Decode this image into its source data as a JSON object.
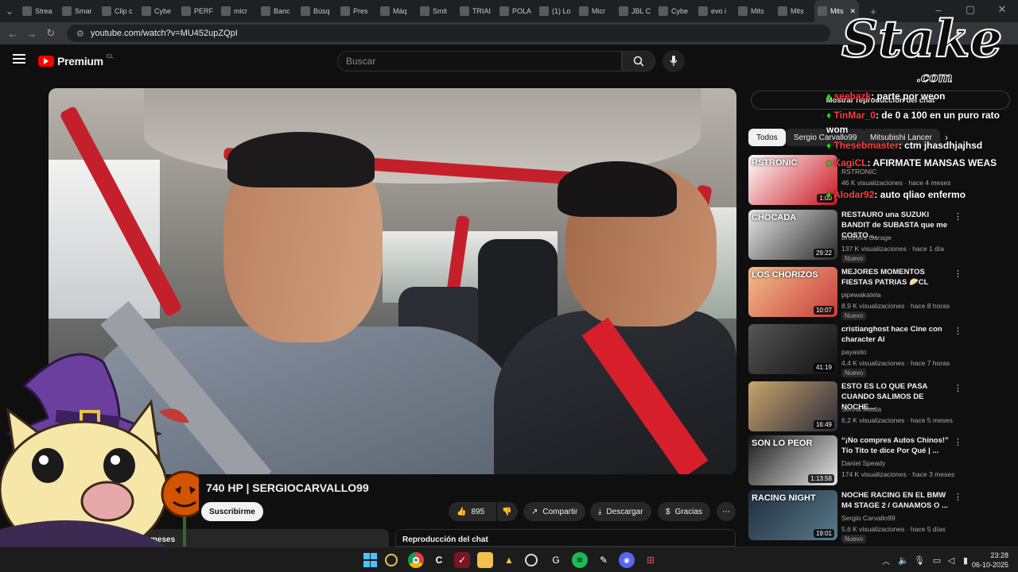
{
  "tabs": [
    {
      "label": "Strea",
      "icon": "twitch-icon"
    },
    {
      "label": "Smar",
      "icon": "triangle-icon"
    },
    {
      "label": "Clip c",
      "icon": "triangle-icon"
    },
    {
      "label": "Cybe",
      "icon": "globe-icon"
    },
    {
      "label": "PERF",
      "icon": "logo-icon"
    },
    {
      "label": "micr",
      "icon": "puzzle-icon"
    },
    {
      "label": "Banc",
      "icon": "ir-icon"
    },
    {
      "label": "Búsq",
      "icon": "ir-icon"
    },
    {
      "label": "Pres",
      "icon": "ir-icon"
    },
    {
      "label": "Máq",
      "icon": "ir-icon"
    },
    {
      "label": "Smit",
      "icon": "ir-icon"
    },
    {
      "label": "TRIAI",
      "icon": "t-icon"
    },
    {
      "label": "POLA",
      "icon": "google-icon"
    },
    {
      "label": "(1) Lo",
      "icon": "youtube-icon"
    },
    {
      "label": "Micr",
      "icon": "puzzle-icon"
    },
    {
      "label": "JBL C",
      "icon": "jbl-icon"
    },
    {
      "label": "Cybe",
      "icon": "shield-icon"
    },
    {
      "label": "evo i",
      "icon": "google-icon"
    },
    {
      "label": "Mits",
      "icon": "mitsubishi-icon"
    },
    {
      "label": "Mits",
      "icon": "mitsubishi-icon"
    },
    {
      "label": "Mits",
      "icon": "mitsubishi-icon"
    }
  ],
  "address": {
    "url": "youtube.com/watch?v=MU452upZQpI"
  },
  "youtube": {
    "logo": "Premium",
    "region": "CL",
    "search_placeholder": "Buscar",
    "video_title_partial": "ut",
    "video_title_rest": "740 HP | SERGIOCARVALLO99",
    "subscribe_label": "Suscribirme",
    "likes": "895",
    "share_label": "Compartir",
    "download_label": "Descargar",
    "thanks_label": "Gracias",
    "desc_partial": "meses",
    "chat_replay_label": "Reproducción del chat",
    "show_chat_label": "Mostrar reproducción del chat"
  },
  "chips": [
    {
      "label": "Todos",
      "active": true
    },
    {
      "label": "Sergio Carvallo99",
      "active": false
    },
    {
      "label": "Mitsubishi Lancer",
      "active": false
    }
  ],
  "recommendations": [
    {
      "title": "",
      "channel": "RSTRONIC",
      "meta": "46 K visualizaciones · hace 4 meses",
      "duration": "1:00",
      "badge": "",
      "thumb_text": "RSTRONIC"
    },
    {
      "title": "RESTAURO una SUZUKI BANDIT de SUBASTA que me COSTO ...",
      "channel": "Brothers Garage",
      "meta": "137 K visualizaciones · hace 1 día",
      "duration": "29:22",
      "badge": "Nuevo",
      "thumb_text": "CHOCADA"
    },
    {
      "title": "MEJORES MOMENTOS FIESTAS PATRIAS 🥟CL",
      "channel": "pipewakatela",
      "meta": "8,9 K visualizaciones · hace 8 horas",
      "duration": "10:07",
      "badge": "Nuevo",
      "thumb_text": "LOS CHORIZOS"
    },
    {
      "title": "cristianghost hace Cine con character AI",
      "channel": "payasito",
      "meta": "4,4 K visualizaciones · hace 7 horas",
      "duration": "41:19",
      "badge": "Nuevo",
      "thumb_text": ""
    },
    {
      "title": "ESTO ES LO QUE PASA CUANDO SALIMOS DE NOCHE...",
      "channel": "Senna Media",
      "meta": "6,2 K visualizaciones · hace 5 meses",
      "duration": "16:49",
      "badge": "",
      "thumb_text": ""
    },
    {
      "title": "“¡No compres Autos Chinos!” Tío Tito te dice Por Qué | ...",
      "channel": "Daniel Speady",
      "meta": "174 K visualizaciones · hace 3 meses",
      "duration": "1:13:58",
      "badge": "",
      "thumb_text": "SON LO PEOR"
    },
    {
      "title": "NOCHE RACING EN EL BMW M4 STAGE 2 / GANAMOS O ...",
      "channel": "Sergio Carvallo99",
      "meta": "5,6 K visualizaciones · hace 5 días",
      "duration": "19:01",
      "badge": "Nuevo",
      "thumb_text": "RACING NIGHT"
    }
  ],
  "stream_chat": [
    {
      "user": "seebazk",
      "text": ": parte por weon"
    },
    {
      "user": "TinMar_0",
      "text": ": de 0 a 100 en un puro rato wom"
    },
    {
      "user": "Thesebmaster",
      "text": ": ctm jhasdhjajhsd"
    },
    {
      "user": "KagiCL",
      "text": ": AFIRMATE MANSAS WEAS"
    },
    {
      "user": "Alodar92",
      "text": ": auto qliao enfermo"
    }
  ],
  "overlay": {
    "brand": "Stake",
    "brand_sub": ".com"
  },
  "taskbar": {
    "time": "23:28",
    "date": "06-10-2025"
  },
  "colors": {
    "accent_red": "#ff0000",
    "cage_red": "#c4202b",
    "chat_user_red": "#ff3b3b"
  }
}
